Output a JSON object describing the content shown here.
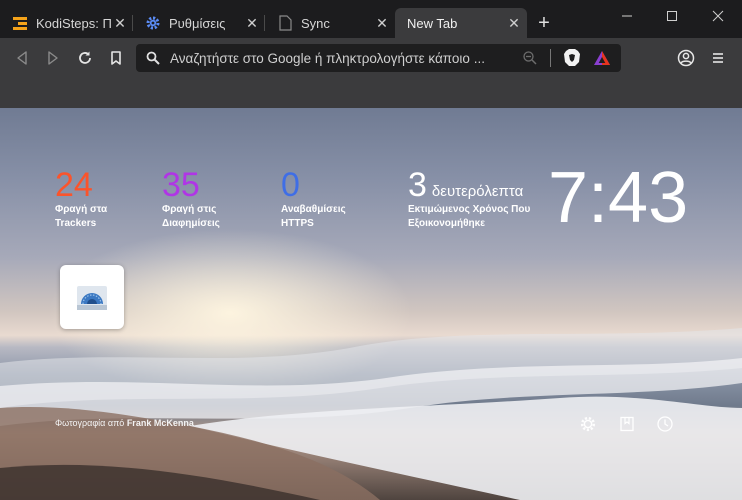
{
  "tabs": [
    {
      "title": "KodiSteps: Πώ",
      "icon": "kodisteps-logo-icon"
    },
    {
      "title": "Ρυθμίσεις",
      "icon": "settings-gear-icon"
    },
    {
      "title": "Sync",
      "icon": "document-icon"
    },
    {
      "title": "New Tab",
      "icon": "",
      "active": true
    }
  ],
  "omnibox": {
    "placeholder": "Αναζητήστε στο Google ή πληκτρολογήστε κάποιο ..."
  },
  "stats": [
    {
      "value": "24",
      "label_line1": "Φραγή στα",
      "label_line2": "Trackers",
      "color": "#fb542b"
    },
    {
      "value": "35",
      "label_line1": "Φραγή στις",
      "label_line2": "Διαφημίσεις",
      "color": "#b035e6"
    },
    {
      "value": "0",
      "label_line1": "Αναβαθμίσεις",
      "label_line2": "HTTPS",
      "color": "#3f6ee6"
    }
  ],
  "time_saved": {
    "value": "3",
    "unit": "δευτερόλεπτα",
    "label_line1": "Εκτιμώμενος Χρόνος Που",
    "label_line2": "Εξοικονομήθηκε"
  },
  "clock": "7:43",
  "photo_credit": {
    "prefix": "Φωτογραφία από",
    "author": "Frank McKenna"
  },
  "colors": {
    "tabstrip": "#1c1c1e",
    "toolbar": "#3b3b3d",
    "omnibox": "#1e1e1f"
  }
}
